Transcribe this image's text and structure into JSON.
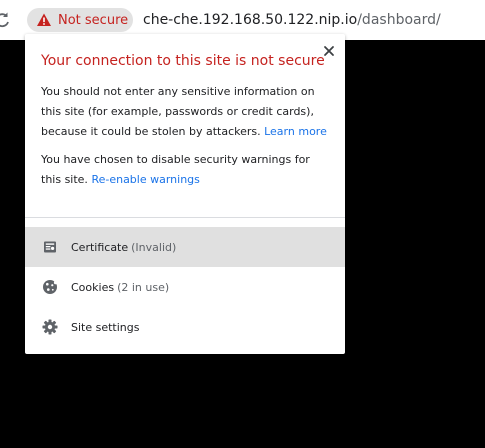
{
  "omnibox": {
    "security_label": "Not secure",
    "url_host": "che-che.192.168.50.122.nip.io",
    "url_path": "/dashboard/"
  },
  "popup": {
    "title": "Your connection to this site is not secure",
    "warning_text": "You should not enter any sensitive information on this site (for example, passwords or credit cards), because it could be stolen by attackers.",
    "learn_more_link": "Learn more",
    "disabled_text": "You have chosen to disable security warnings for this site.",
    "reenable_link": "Re-enable warnings",
    "items": [
      {
        "label": "Certificate",
        "secondary": "(Invalid)",
        "icon": "certificate-icon"
      },
      {
        "label": "Cookies",
        "secondary": "(2 in use)",
        "icon": "cookie-icon"
      },
      {
        "label": "Site settings",
        "secondary": "",
        "icon": "gear-icon"
      }
    ]
  },
  "colors": {
    "warning_red": "#c5221f",
    "link_blue": "#1a73e8",
    "hover_gray": "#e0e0e0",
    "page_background": "#000000"
  }
}
